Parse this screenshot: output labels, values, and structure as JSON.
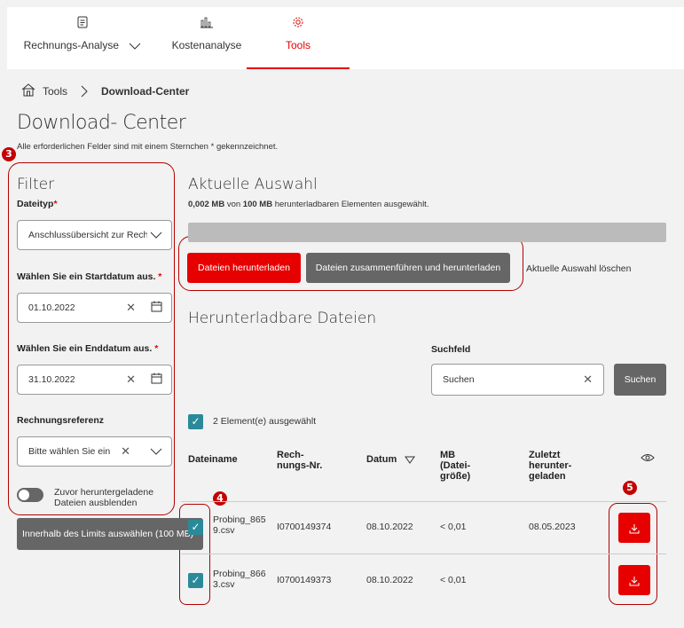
{
  "nav": {
    "tabs": [
      {
        "label": "Rechnungs-Analyse",
        "icon": "document-icon"
      },
      {
        "label": "Kostenanalyse",
        "icon": "chart-icon"
      },
      {
        "label": "Tools",
        "icon": "gear-icon"
      }
    ]
  },
  "breadcrumb": {
    "home": "home-icon",
    "tools": "Tools",
    "current": "Download-Center"
  },
  "page": {
    "title": "Download- Center",
    "hint": "Alle erforderlichen Felder sind mit einem Sternchen * gekennzeichnet."
  },
  "annotations": {
    "b3": "3",
    "b4": "4",
    "b5a": "5",
    "b5b": "5"
  },
  "filter": {
    "title": "Filter",
    "dateityp_label": "Dateityp",
    "dateityp_value": "Anschlussübersicht zur Rech",
    "start_label": "Wählen Sie ein Startdatum aus.",
    "start_value": "01.10.2022",
    "end_label": "Wählen Sie ein Enddatum aus.",
    "end_value": "31.10.2022",
    "ref_label": "Rechnungsreferenz",
    "ref_placeholder": "Bitte wählen Sie ein",
    "toggle_label_1": "Zuvor heruntergeladene",
    "toggle_label_2": "Dateien ausblenden",
    "required_mark": "*"
  },
  "limit_button": "Innerhalb des Limits auswählen (100 MB)",
  "selection": {
    "title": "Aktuelle Auswahl",
    "size_used": "0,002 MB",
    "size_mid": " von ",
    "size_total": "100 MB",
    "size_tail": " herunterladbaren Elementen ausgewählt.",
    "progress": 2e-05,
    "download_button": "Dateien herunterladen",
    "merge_button": "Dateien zusammenführen und herunterladen",
    "clear_link": "Aktuelle Auswahl löschen"
  },
  "files": {
    "title": "Herunterladbare Dateien",
    "search_label": "Suchfeld",
    "search_placeholder": "Suchen",
    "search_button": "Suchen",
    "selected_count": "2 Element(e) ausgewählt",
    "headers": {
      "name": "Dateiname",
      "nr_1": "Rech-",
      "nr_2": "nungs-Nr.",
      "date": "Datum",
      "mb_1": "MB",
      "mb_2": "(Datei-",
      "mb_3": "größe)",
      "last_1": "Zuletzt",
      "last_2": "herunter-",
      "last_3": "geladen"
    },
    "rows": [
      {
        "name_1": "Probing_865",
        "name_2": "9.csv",
        "nr": "I0700149374",
        "date": "08.10.2022",
        "mb": "< 0,01",
        "last": "08.05.2023"
      },
      {
        "name_1": "Probing_866",
        "name_2": "3.csv",
        "nr": "I0700149373",
        "date": "08.10.2022",
        "mb": "< 0,01",
        "last": ""
      }
    ]
  },
  "colors": {
    "accent": "#e60000",
    "checkbox": "#2a8a9a",
    "annotation": "#b30000"
  }
}
